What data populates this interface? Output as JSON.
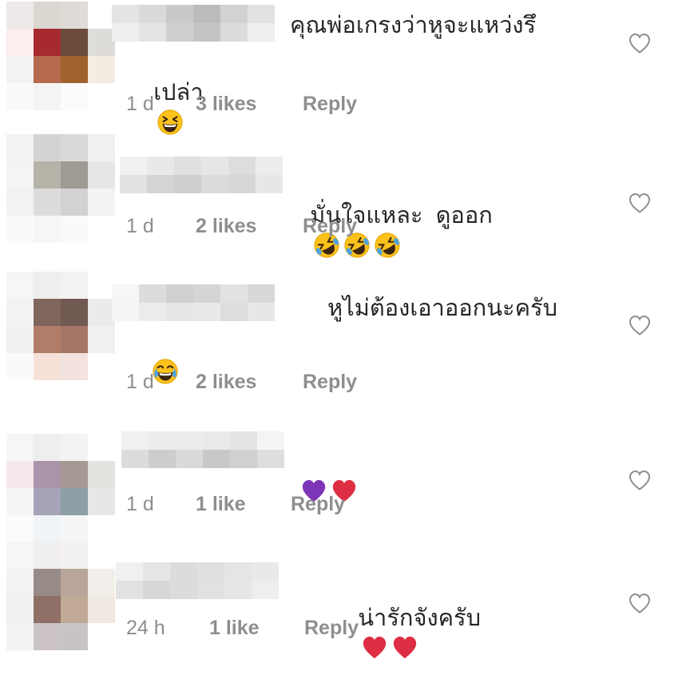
{
  "colors": {
    "text": "#262626",
    "meta": "#8e8e8e",
    "heart_outline": "#8e8e8e"
  },
  "comments": [
    {
      "text": "คุณพ่อเกรงว่าหูจะแหว่งรึ",
      "text_line2": "เปล่า",
      "emojis": [
        "grinning-squinting-face-emoji"
      ],
      "time": "1 d",
      "likes": "3 likes",
      "reply": "Reply",
      "avatar_colors": [
        "#ece9e8",
        "#dcd6d0",
        "#dfdcd8",
        "#ffffff",
        "#fbeeee",
        "#a72a31",
        "#6b4c3c",
        "#dedcd8",
        "#f3f2f2",
        "#b5694f",
        "#a0622d",
        "#f4ece2",
        "#fafafa",
        "#f4f4f4",
        "#fbfbfb",
        "#ffffff"
      ],
      "name_colors": [
        "#e4e4e4",
        "#dadada",
        "#c9c9c9",
        "#bcbcbc",
        "#d2d2d2",
        "#e2e2e2",
        "#eeeeee",
        "#e4e4e4",
        "#cfcfcf",
        "#c4c4c4",
        "#dcdcdc",
        "#efefef"
      ],
      "heart_icon": "heart-outline-icon"
    },
    {
      "text": "มั่นใจแหละ  ดูออก",
      "emojis": [
        "rolling-laughing-emoji",
        "rolling-laughing-emoji",
        "rolling-laughing-emoji"
      ],
      "time": "1 d",
      "likes": "2 likes",
      "reply": "Reply",
      "avatar_colors": [
        "#f2f2f2",
        "#d3d3d3",
        "#d9d9d9",
        "#f0f0f0",
        "#f4f4f4",
        "#b5b3a7",
        "#9e9a94",
        "#e6e6e6",
        "#f2f2f2",
        "#dcdcdc",
        "#d2d2d2",
        "#f3f3f3",
        "#fafafa",
        "#f6f6f6",
        "#fafafa",
        "#ffffff"
      ],
      "name_colors": [
        "#f0f0f0",
        "#e9e9e9",
        "#e0e0e0",
        "#e6e6e6",
        "#dddddd",
        "#ececec",
        "#e2e2e2",
        "#d5d5d5",
        "#cfcfcf",
        "#dcdcdc",
        "#d7d7d7",
        "#e7e7e7"
      ],
      "heart_icon": "heart-outline-icon"
    },
    {
      "text": "หูไม่ต้องเอาออกนะครับ",
      "emojis_line2": [
        "tears-of-joy-emoji"
      ],
      "time": "1 d",
      "likes": "2 likes",
      "reply": "Reply",
      "avatar_colors": [
        "#f6f6f6",
        "#eeeeee",
        "#f2f2f2",
        "#ffffff",
        "#f2f2f2",
        "#7f665c",
        "#715a52",
        "#ebebeb",
        "#f1f1f1",
        "#b17c68",
        "#a57568",
        "#f0f0f0",
        "#fafafa",
        "#f6e1d9",
        "#f3e3de",
        "#ffffff"
      ],
      "name_colors": [
        "#f6f6f6",
        "#dcdcdc",
        "#d0d0d0",
        "#d5d5d5",
        "#e2e2e2",
        "#d8d8d8",
        "#f5f5f5",
        "#ececec",
        "#e6e6e6",
        "#e9e9e9",
        "#dddddd",
        "#e7e7e7"
      ],
      "heart_icon": "heart-outline-icon"
    },
    {
      "text": "",
      "emojis": [
        "purple-heart-emoji",
        "red-heart-emoji"
      ],
      "time": "1 d",
      "likes": "1 like",
      "reply": "Reply",
      "avatar_colors": [
        "#f6f6f6",
        "#eeeeee",
        "#f3f3f3",
        "#ffffff",
        "#f4e8ea",
        "#aa94aa",
        "#a59993",
        "#e2e2de",
        "#f5f5f5",
        "#a6a3b9",
        "#8d9ea6",
        "#e7e7e7",
        "#fbfbfb",
        "#f1f4f6",
        "#f5f5f5",
        "#ffffff"
      ],
      "name_colors": [
        "#f0f0f0",
        "#ececec",
        "#ececec",
        "#eaeaea",
        "#e4e4e4",
        "#f4f4f4",
        "#dcdcdc",
        "#cdcdcd",
        "#d9d9d9",
        "#c8c8c8",
        "#d0d0d0",
        "#dedede"
      ],
      "heart_icon": "heart-outline-icon"
    },
    {
      "text": "น่ารักจังครับ ",
      "emojis": [
        "red-heart-emoji",
        "red-heart-emoji"
      ],
      "time": "24 h",
      "likes": "1 like",
      "reply": "Reply",
      "avatar_colors": [
        "#f6f6f6",
        "#f1eeee",
        "#f3f1ef",
        "#ffffff",
        "#f4f1f2",
        "#978b88",
        "#b9a59a",
        "#f1eeea",
        "#f1f1f1",
        "#8f7066",
        "#c0a996",
        "#f0e9e2",
        "#f3f3f3",
        "#cbc3c6",
        "#c8c4c6",
        "#ffffff"
      ],
      "name_colors": [
        "#f0f0f0",
        "#e6e6e6",
        "#dcdcdc",
        "#e0e0e0",
        "#e5e5e5",
        "#e9e9e9",
        "#e2e2e2",
        "#d7d7d7",
        "#dcdcdc",
        "#e1e1e1",
        "#e6e6e6",
        "#eeeeee"
      ],
      "heart_icon": "heart-outline-icon"
    }
  ]
}
